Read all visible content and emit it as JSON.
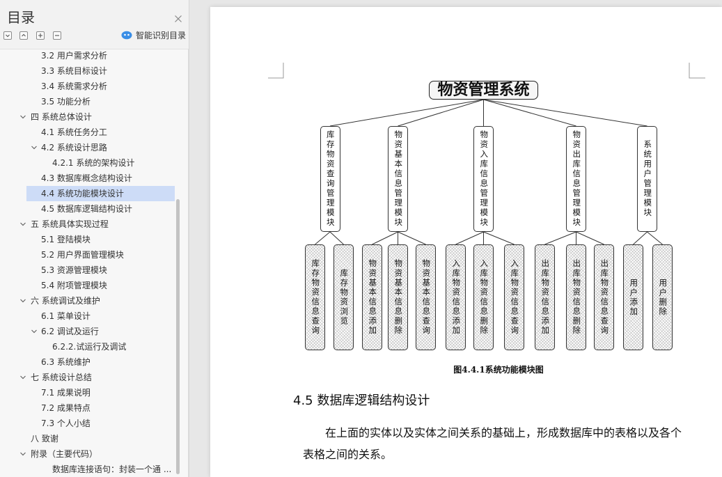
{
  "colors": {
    "selection_bg": "#cddcf7",
    "smart_icon": "#3a8ee6",
    "sidebar_bg": "#f2f2f2",
    "workspace_bg": "#e7e7e7",
    "page_bg": "#ffffff"
  },
  "sidebar": {
    "title": "目录",
    "close_icon": "close-icon",
    "tools": [
      {
        "icon": "chevron-down-icon"
      },
      {
        "icon": "chevron-up-icon"
      },
      {
        "icon": "plus-icon"
      },
      {
        "icon": "minus-icon"
      }
    ],
    "smart_toc": {
      "icon": "smart-cloud-icon",
      "label": "智能识别目录"
    },
    "items": [
      {
        "label": "3.2 用户需求分析",
        "level": 2
      },
      {
        "label": "3.3 系统目标设计",
        "level": 2
      },
      {
        "label": "3.4 系统需求分析",
        "level": 2
      },
      {
        "label": "3.5 功能分析",
        "level": 2
      },
      {
        "label": "四 系统总体设计",
        "level": 1,
        "expanded": true
      },
      {
        "label": "4.1 系统任务分工",
        "level": 2
      },
      {
        "label": "4.2 系统设计思路",
        "level": 2,
        "expanded": true
      },
      {
        "label": "4.2.1 系统的架构设计",
        "level": 3
      },
      {
        "label": "4.3 数据库概念结构设计",
        "level": 2
      },
      {
        "label": "4.4 系统功能模块设计",
        "level": 2,
        "selected": true
      },
      {
        "label": "4.5 数据库逻辑结构设计",
        "level": 2
      },
      {
        "label": "五 系统具体实现过程",
        "level": 1,
        "expanded": true
      },
      {
        "label": "5.1 登陆模块",
        "level": 2
      },
      {
        "label": "5.2 用户界面管理模块",
        "level": 2
      },
      {
        "label": "5.3 资源管理模块",
        "level": 2
      },
      {
        "label": "5.4 附项管理模块",
        "level": 2
      },
      {
        "label": "六 系统调试及维护",
        "level": 1,
        "expanded": true
      },
      {
        "label": "6.1 菜单设计",
        "level": 2
      },
      {
        "label": "6.2 调试及运行",
        "level": 2,
        "expanded": true
      },
      {
        "label": "6.2.2.试运行及调试",
        "level": 3
      },
      {
        "label": "6.3 系统维护",
        "level": 2
      },
      {
        "label": "七 系统设计总结",
        "level": 1,
        "expanded": true
      },
      {
        "label": "7.1 成果说明",
        "level": 2
      },
      {
        "label": "7.2 成果特点",
        "level": 2
      },
      {
        "label": "7.3 个人小结",
        "level": 2
      },
      {
        "label": "八 致谢",
        "level": 1
      },
      {
        "label": "附录（主要代码）",
        "level": 1,
        "expanded": true
      },
      {
        "label": "数据库连接语句：封装一个通 ...",
        "level": 3
      }
    ]
  },
  "document": {
    "diagram": {
      "root": "物资管理系统",
      "modules": [
        {
          "label": "库存物资查询管理模块",
          "children": [
            "库存物资信息查询",
            "库存物资浏览"
          ]
        },
        {
          "label": "物资基本信息管理模块",
          "children": [
            "物资基本信息添加",
            "物资基本信息删除",
            "物资基本信息查询"
          ]
        },
        {
          "label": "物资入库信息管理模块",
          "children": [
            "入库物资信息添加",
            "入库物资信息删除",
            "入库物资信息查询"
          ]
        },
        {
          "label": "物资出库信息管理模块",
          "children": [
            "出库物资信息添加",
            "出库物资信息删除",
            "出库物资信息查询"
          ]
        },
        {
          "label": "系统用户管理模块",
          "children": [
            "用户添加",
            "用户删除"
          ]
        }
      ]
    },
    "caption": "图4.4.1系统功能模块图",
    "heading": "4.5 数据库逻辑结构设计",
    "paragraph": [
      "在上面的实体以及实体之间关系的基础上，形成数据库中的表格以及各个",
      "表格之间的关系。"
    ]
  }
}
